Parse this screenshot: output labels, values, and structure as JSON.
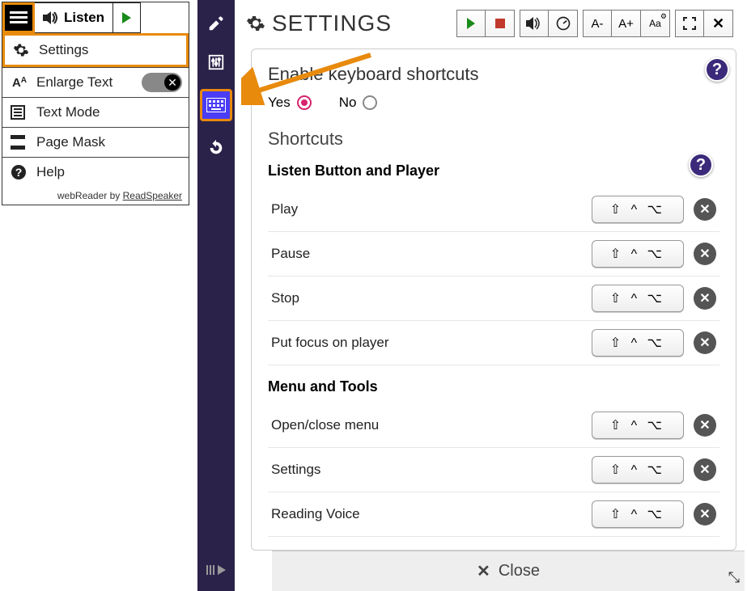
{
  "widget": {
    "hamburger": "☰",
    "listen": "Listen",
    "menu": {
      "settings": "Settings",
      "enlarge": "Enlarge Text",
      "textmode": "Text Mode",
      "pagemask": "Page Mask",
      "help": "Help"
    },
    "footer_prefix": "webReader by ",
    "footer_link": "ReadSpeaker"
  },
  "panel": {
    "title": "SETTINGS",
    "tools": {
      "aminus": "A-",
      "aplus": "A+",
      "aconfig": "Aa"
    },
    "enable_heading": "Enable keyboard shortcuts",
    "yes": "Yes",
    "no": "No",
    "shortcuts_heading": "Shortcuts",
    "help": "?",
    "groups": [
      {
        "title": "Listen Button and Player",
        "rows": [
          {
            "label": "Play",
            "keys": "⇧ ^ ⌥"
          },
          {
            "label": "Pause",
            "keys": "⇧ ^ ⌥"
          },
          {
            "label": "Stop",
            "keys": "⇧ ^ ⌥"
          },
          {
            "label": "Put focus on player",
            "keys": "⇧ ^ ⌥"
          }
        ]
      },
      {
        "title": "Menu and Tools",
        "rows": [
          {
            "label": "Open/close menu",
            "keys": "⇧ ^ ⌥"
          },
          {
            "label": "Settings",
            "keys": "⇧ ^ ⌥"
          },
          {
            "label": "Reading Voice",
            "keys": "⇧ ^ ⌥"
          }
        ]
      }
    ],
    "close": "Close"
  }
}
